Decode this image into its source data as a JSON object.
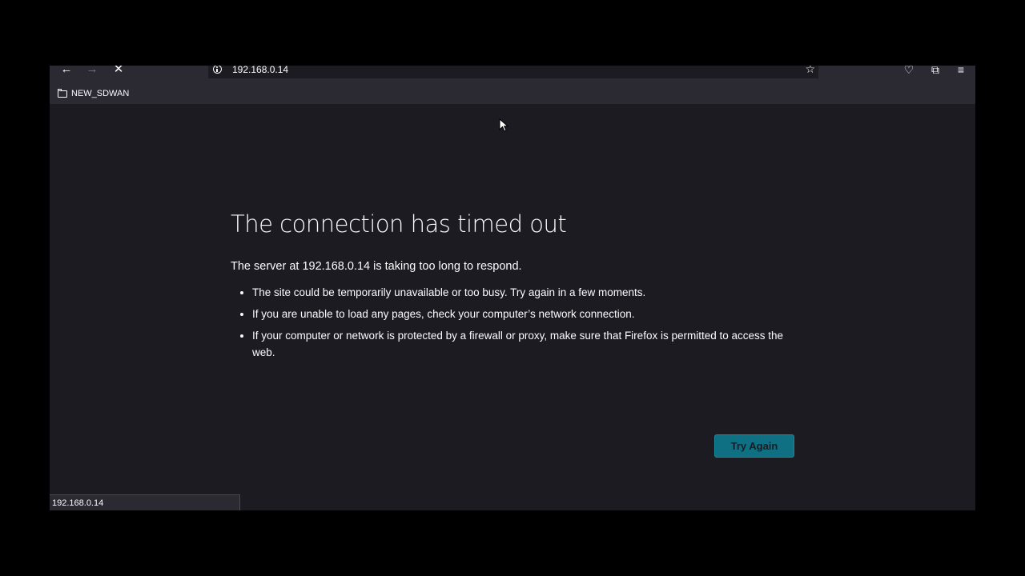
{
  "toolbar": {
    "back_icon": "←",
    "forward_icon": "→",
    "stop_icon": "✕",
    "url": "192.168.0.14",
    "star_icon": "☆",
    "pocket_icon": "♡",
    "extensions_icon": "⧉",
    "menu_icon": "≡"
  },
  "bookmarks": [
    {
      "label": "NEW_SDWAN"
    }
  ],
  "error": {
    "title": "The connection has timed out",
    "description": "The server at 192.168.0.14 is taking too long to respond.",
    "tips": [
      "The site could be temporarily unavailable or too busy. Try again in a few moments.",
      "If you are unable to load any pages, check your computer’s network connection.",
      "If your computer or network is protected by a firewall or proxy, make sure that Firefox is permitted to access the web."
    ],
    "button_label": "Try Again"
  },
  "status_bar": {
    "text": "192.168.0.14"
  },
  "colors": {
    "page_bg": "#1c1b22",
    "toolbar_bg": "#2b2a33",
    "button_bg": "#0e7082"
  }
}
